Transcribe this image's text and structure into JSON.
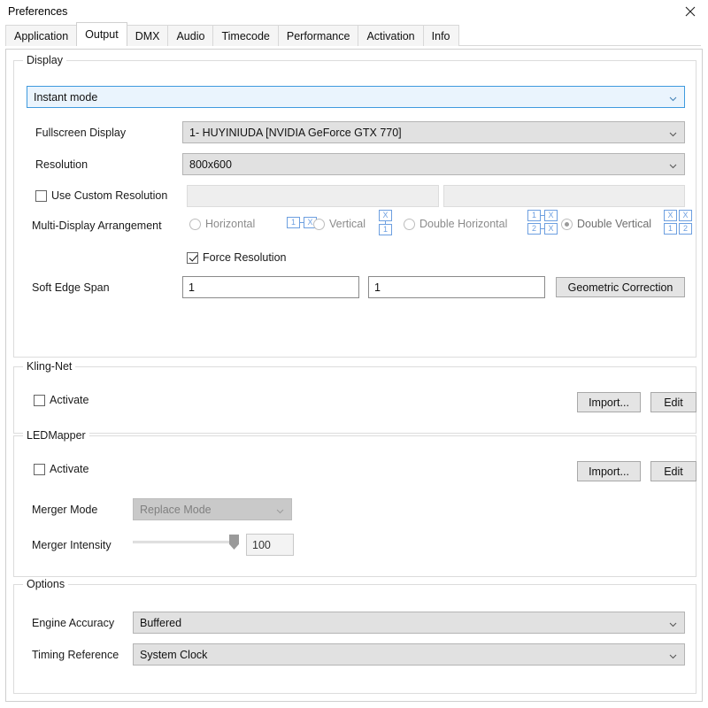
{
  "window": {
    "title": "Preferences",
    "close_icon": "close-icon"
  },
  "tabs": [
    {
      "label": "Application",
      "active": false
    },
    {
      "label": "Output",
      "active": true
    },
    {
      "label": "DMX",
      "active": false
    },
    {
      "label": "Audio",
      "active": false
    },
    {
      "label": "Timecode",
      "active": false
    },
    {
      "label": "Performance",
      "active": false
    },
    {
      "label": "Activation",
      "active": false
    },
    {
      "label": "Info",
      "active": false
    }
  ],
  "display": {
    "legend": "Display",
    "mode": {
      "value": "Instant mode",
      "arrow_icon": "chevron-down-icon"
    },
    "fullscreen_display": {
      "label": "Fullscreen Display",
      "value": "1- HUYINIUDA [NVIDIA GeForce GTX 770]"
    },
    "resolution": {
      "label": "Resolution",
      "value": "800x600"
    },
    "use_custom_resolution": {
      "label": "Use Custom Resolution",
      "checked": false,
      "width_value": "",
      "height_value": ""
    },
    "multi_display": {
      "label": "Multi-Display Arrangement",
      "options": [
        {
          "label": "Horizontal",
          "selected": false,
          "icon": "arrange-horizontal-icon",
          "cells": [
            "1",
            "X"
          ]
        },
        {
          "label": "Vertical",
          "selected": false,
          "icon": "arrange-vertical-icon",
          "cells": [
            "X",
            "1"
          ]
        },
        {
          "label": "Double Horizontal",
          "selected": false,
          "icon": "arrange-double-horizontal-icon",
          "cells": [
            "1",
            "X",
            "2",
            "X"
          ]
        },
        {
          "label": "Double Vertical",
          "selected": true,
          "icon": "arrange-double-vertical-icon",
          "cells": [
            "X",
            "X",
            "1",
            "2"
          ]
        }
      ]
    },
    "force_resolution": {
      "label": "Force Resolution",
      "checked": true
    },
    "soft_edge_span": {
      "label": "Soft Edge Span",
      "value_1": "1",
      "value_2": "1"
    },
    "geometric_correction_button": "Geometric Correction"
  },
  "kling_net": {
    "legend": "Kling-Net",
    "activate": {
      "label": "Activate",
      "checked": false
    },
    "import_button": "Import...",
    "edit_button": "Edit"
  },
  "led_mapper": {
    "legend": "LEDMapper",
    "activate": {
      "label": "Activate",
      "checked": false
    },
    "import_button": "Import...",
    "edit_button": "Edit",
    "merger_mode": {
      "label": "Merger Mode",
      "value": "Replace Mode",
      "disabled": true
    },
    "merger_intensity": {
      "label": "Merger Intensity",
      "value": "100",
      "percent": 100
    }
  },
  "options": {
    "legend": "Options",
    "engine_accuracy": {
      "label": "Engine Accuracy",
      "value": "Buffered"
    },
    "timing_reference": {
      "label": "Timing Reference",
      "value": "System Clock"
    }
  }
}
